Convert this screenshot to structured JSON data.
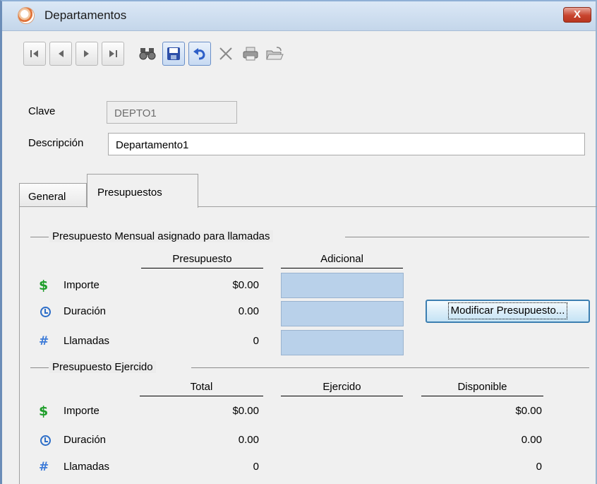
{
  "window": {
    "title": "Departamentos",
    "close_label": "X"
  },
  "toolbar": {
    "buttons": [
      "first-record",
      "previous-record",
      "next-record",
      "last-record",
      "find",
      "save",
      "undo",
      "delete",
      "print",
      "open-folder"
    ]
  },
  "form": {
    "clave_label": "Clave",
    "clave_value": "DEPTO1",
    "descripcion_label": "Descripción",
    "descripcion_value": "Departamento1"
  },
  "tabs": [
    {
      "label": "General",
      "active": false
    },
    {
      "label": "Presupuestos",
      "active": true
    }
  ],
  "asignado": {
    "group_title": "Presupuesto Mensual asignado para llamadas",
    "col_presupuesto": "Presupuesto",
    "col_adicional": "Adicional",
    "rows": [
      {
        "icon": "dollar-icon",
        "label": "Importe",
        "presupuesto": "$0.00"
      },
      {
        "icon": "clock-icon",
        "label": "Duración",
        "presupuesto": "0.00"
      },
      {
        "icon": "hash-icon",
        "label": "Llamadas",
        "presupuesto": "0"
      }
    ],
    "modificar_button": "Modificar Presupuesto..."
  },
  "ejercido": {
    "group_title": "Presupuesto Ejercido",
    "col_total": "Total",
    "col_ejercido": "Ejercido",
    "col_disponible": "Disponible",
    "rows": [
      {
        "icon": "dollar-icon",
        "label": "Importe",
        "total": "$0.00",
        "ejercido": "",
        "disponible": "$0.00"
      },
      {
        "icon": "clock-icon",
        "label": "Duración",
        "total": "0.00",
        "ejercido": "",
        "disponible": "0.00"
      },
      {
        "icon": "hash-icon",
        "label": "Llamadas",
        "total": "0",
        "ejercido": "",
        "disponible": "0"
      }
    ]
  },
  "colors": {
    "accent_blue": "#b9d1ea",
    "title_bar": "#c4d6ea",
    "close_red": "#c8442e"
  }
}
